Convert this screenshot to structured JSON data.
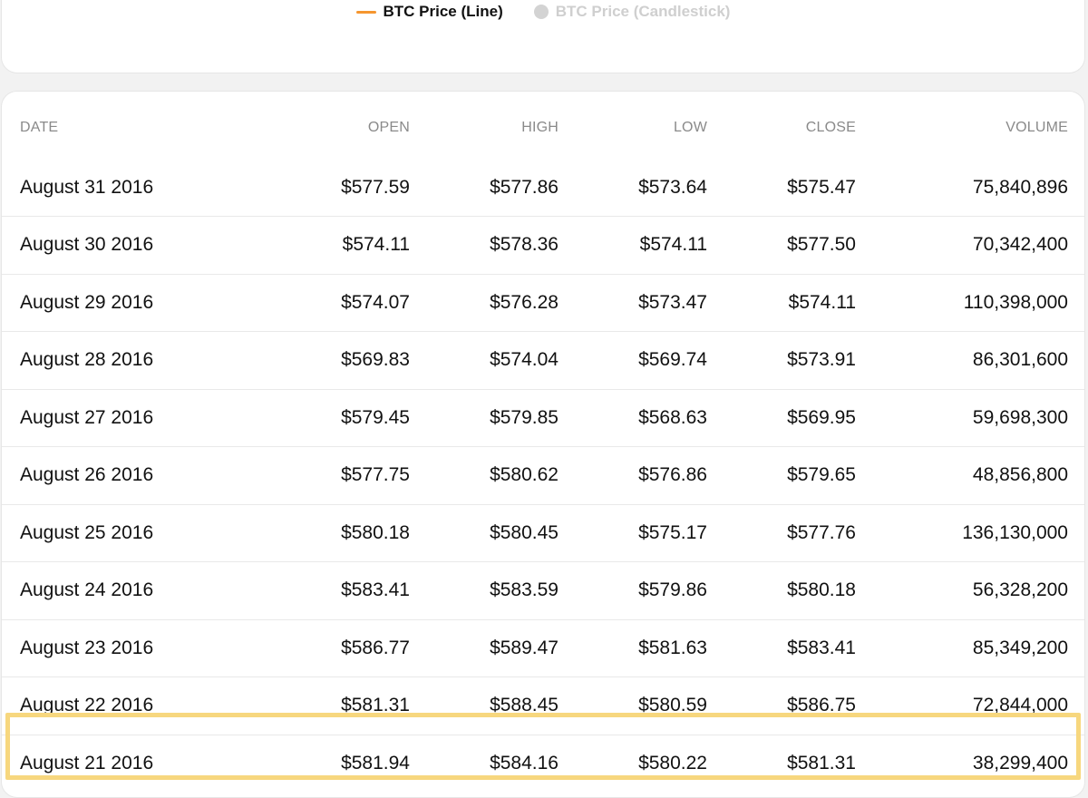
{
  "legend": {
    "items": [
      {
        "label": "BTC Price (Line)",
        "color": "#f5962f",
        "active": true
      },
      {
        "label": "BTC Price (Candlestick)",
        "color": "#d3d3d3",
        "active": false
      }
    ]
  },
  "table": {
    "headers": [
      "DATE",
      "OPEN",
      "HIGH",
      "LOW",
      "CLOSE",
      "VOLUME"
    ],
    "rows": [
      [
        "August 31 2016",
        "$577.59",
        "$577.86",
        "$573.64",
        "$575.47",
        "75,840,896"
      ],
      [
        "August 30 2016",
        "$574.11",
        "$578.36",
        "$574.11",
        "$577.50",
        "70,342,400"
      ],
      [
        "August 29 2016",
        "$574.07",
        "$576.28",
        "$573.47",
        "$574.11",
        "110,398,000"
      ],
      [
        "August 28 2016",
        "$569.83",
        "$574.04",
        "$569.74",
        "$573.91",
        "86,301,600"
      ],
      [
        "August 27 2016",
        "$579.45",
        "$579.85",
        "$568.63",
        "$569.95",
        "59,698,300"
      ],
      [
        "August 26 2016",
        "$577.75",
        "$580.62",
        "$576.86",
        "$579.65",
        "48,856,800"
      ],
      [
        "August 25 2016",
        "$580.18",
        "$580.45",
        "$575.17",
        "$577.76",
        "136,130,000"
      ],
      [
        "August 24 2016",
        "$583.41",
        "$583.59",
        "$579.86",
        "$580.18",
        "56,328,200"
      ],
      [
        "August 23 2016",
        "$586.77",
        "$589.47",
        "$581.63",
        "$583.41",
        "85,349,200"
      ],
      [
        "August 22 2016",
        "$581.31",
        "$588.45",
        "$580.59",
        "$586.75",
        "72,844,000"
      ],
      [
        "August 21 2016",
        "$581.94",
        "$584.16",
        "$580.22",
        "$581.31",
        "38,299,400"
      ]
    ],
    "highlight_color": "#f7d77e"
  }
}
